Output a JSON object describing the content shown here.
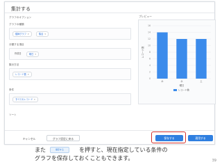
{
  "dialog": {
    "title": "集計する",
    "options_heading": "グラフのオプション",
    "sections": [
      {
        "label": "グラフの種類",
        "pills": [
          {
            "text": "縦棒グラフ",
            "arrow": "▾",
            "blue": true
          },
          {
            "text": "集合",
            "arrow": "▾",
            "blue": true
          }
        ]
      },
      {
        "label": "分類する項目",
        "pills": [
          {
            "text": "作成日",
            "arrow": "",
            "blue": false
          },
          {
            "text": "曜日",
            "arrow": "▾",
            "blue": true
          }
        ]
      },
      {
        "label": "集計方法",
        "pills": [
          {
            "text": "レコード数",
            "arrow": "▾",
            "blue": true
          }
        ]
      },
      {
        "label": "条件",
        "pills": [
          {
            "text": "すべてのレコード",
            "arrow": "▾",
            "blue": true
          }
        ]
      },
      {
        "label": "ソート",
        "pills": []
      }
    ],
    "preview_heading": "プレビュー",
    "buttons": {
      "cancel": "キャンセル",
      "reset": "グラフ設定に戻る",
      "save": "保存する",
      "apply": "適用する"
    }
  },
  "chart_data": {
    "type": "bar",
    "categories": [
      "木",
      "水",
      "土"
    ],
    "values": [
      14,
      12,
      12
    ],
    "xlabel": "曜日",
    "ylabel": "レコード数",
    "yticks": [
      0,
      2,
      4,
      6,
      8,
      10,
      12,
      14,
      16
    ],
    "ylim": [
      0,
      16
    ],
    "legend": [
      "レコード数"
    ],
    "legend_position": "bottom",
    "bar_color": "#3b8beb",
    "grid": true
  },
  "caption": {
    "line1_before": "また",
    "inline_button": "保存する",
    "line1_after": "を押すと、現在指定している条件の",
    "line2": "グラフを保存しておくこともできます。"
  },
  "page_number": "39",
  "colors": {
    "accent": "#2f7fe0",
    "highlight": "#d3322c"
  }
}
